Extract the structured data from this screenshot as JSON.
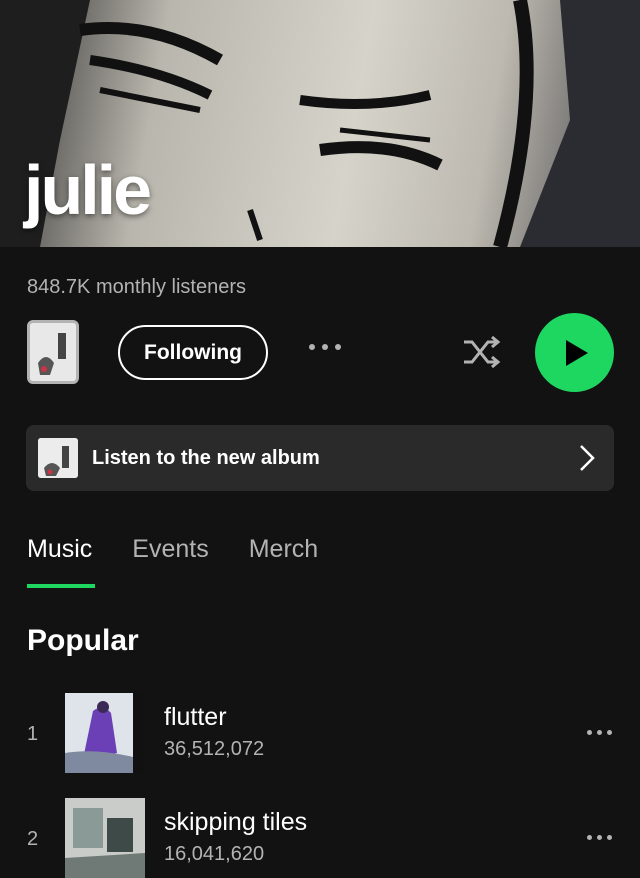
{
  "artist": {
    "name": "julie",
    "monthly_listeners": "848.7K monthly listeners"
  },
  "actions": {
    "follow_label": "Following",
    "accent": "#1ed760"
  },
  "banner": {
    "label": "Listen to the new album"
  },
  "tabs": [
    {
      "label": "Music",
      "active": true
    },
    {
      "label": "Events",
      "active": false
    },
    {
      "label": "Merch",
      "active": false
    }
  ],
  "popular": {
    "title": "Popular",
    "tracks": [
      {
        "rank": "1",
        "title": "flutter",
        "plays": "36,512,072"
      },
      {
        "rank": "2",
        "title": "skipping tiles",
        "plays": "16,041,620"
      }
    ]
  },
  "icons": [
    "more-horizontal-icon",
    "shuffle-icon",
    "play-icon",
    "chevron-right-icon"
  ]
}
